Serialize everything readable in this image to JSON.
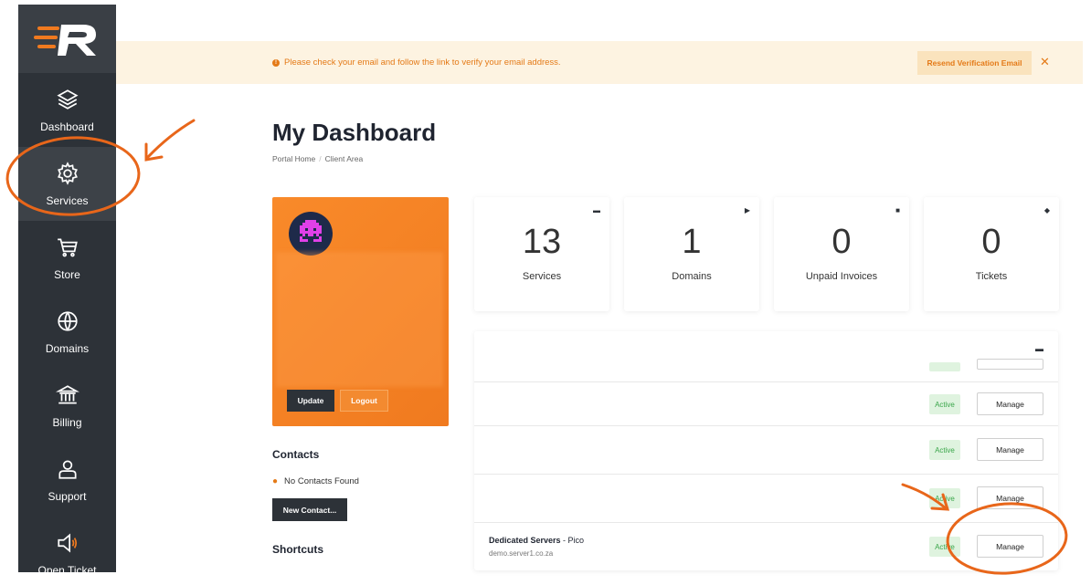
{
  "sidebar": {
    "items": [
      {
        "label": "Dashboard",
        "icon": "layers-icon"
      },
      {
        "label": "Services",
        "icon": "gear-icon"
      },
      {
        "label": "Store",
        "icon": "cart-icon"
      },
      {
        "label": "Domains",
        "icon": "globe-icon"
      },
      {
        "label": "Billing",
        "icon": "bank-icon"
      },
      {
        "label": "Support",
        "icon": "user-support-icon"
      },
      {
        "label": "Open Ticket",
        "icon": "megaphone-icon"
      }
    ]
  },
  "alert": {
    "message": "Please check your email and follow the link to verify your email address.",
    "resend_label": "Resend Verification Email",
    "close_label": "✕"
  },
  "header": {
    "title": "My Dashboard",
    "breadcrumb": [
      "Portal Home",
      "Client Area"
    ]
  },
  "profile": {
    "update_label": "Update",
    "logout_label": "Logout"
  },
  "contacts": {
    "title": "Contacts",
    "empty_text": "No Contacts Found",
    "new_label": "New Contact..."
  },
  "shortcuts": {
    "title": "Shortcuts"
  },
  "stats": [
    {
      "value": "13",
      "label": "Services",
      "icon": "server-icon"
    },
    {
      "value": "1",
      "label": "Domains",
      "icon": "tag-icon"
    },
    {
      "value": "0",
      "label": "Unpaid Invoices",
      "icon": "file-icon"
    },
    {
      "value": "0",
      "label": "Tickets",
      "icon": "comment-icon"
    }
  ],
  "services": {
    "status": "Active",
    "manage_label": "Manage",
    "last_item": {
      "name": "Dedicated Servers",
      "plan": " - Pico",
      "host": "demo.server1.co.za"
    }
  },
  "colors": {
    "accent": "#f07a1f",
    "sidebar": "#2d3238",
    "annotation": "#e8661a",
    "active_badge": "#3aa64a"
  }
}
